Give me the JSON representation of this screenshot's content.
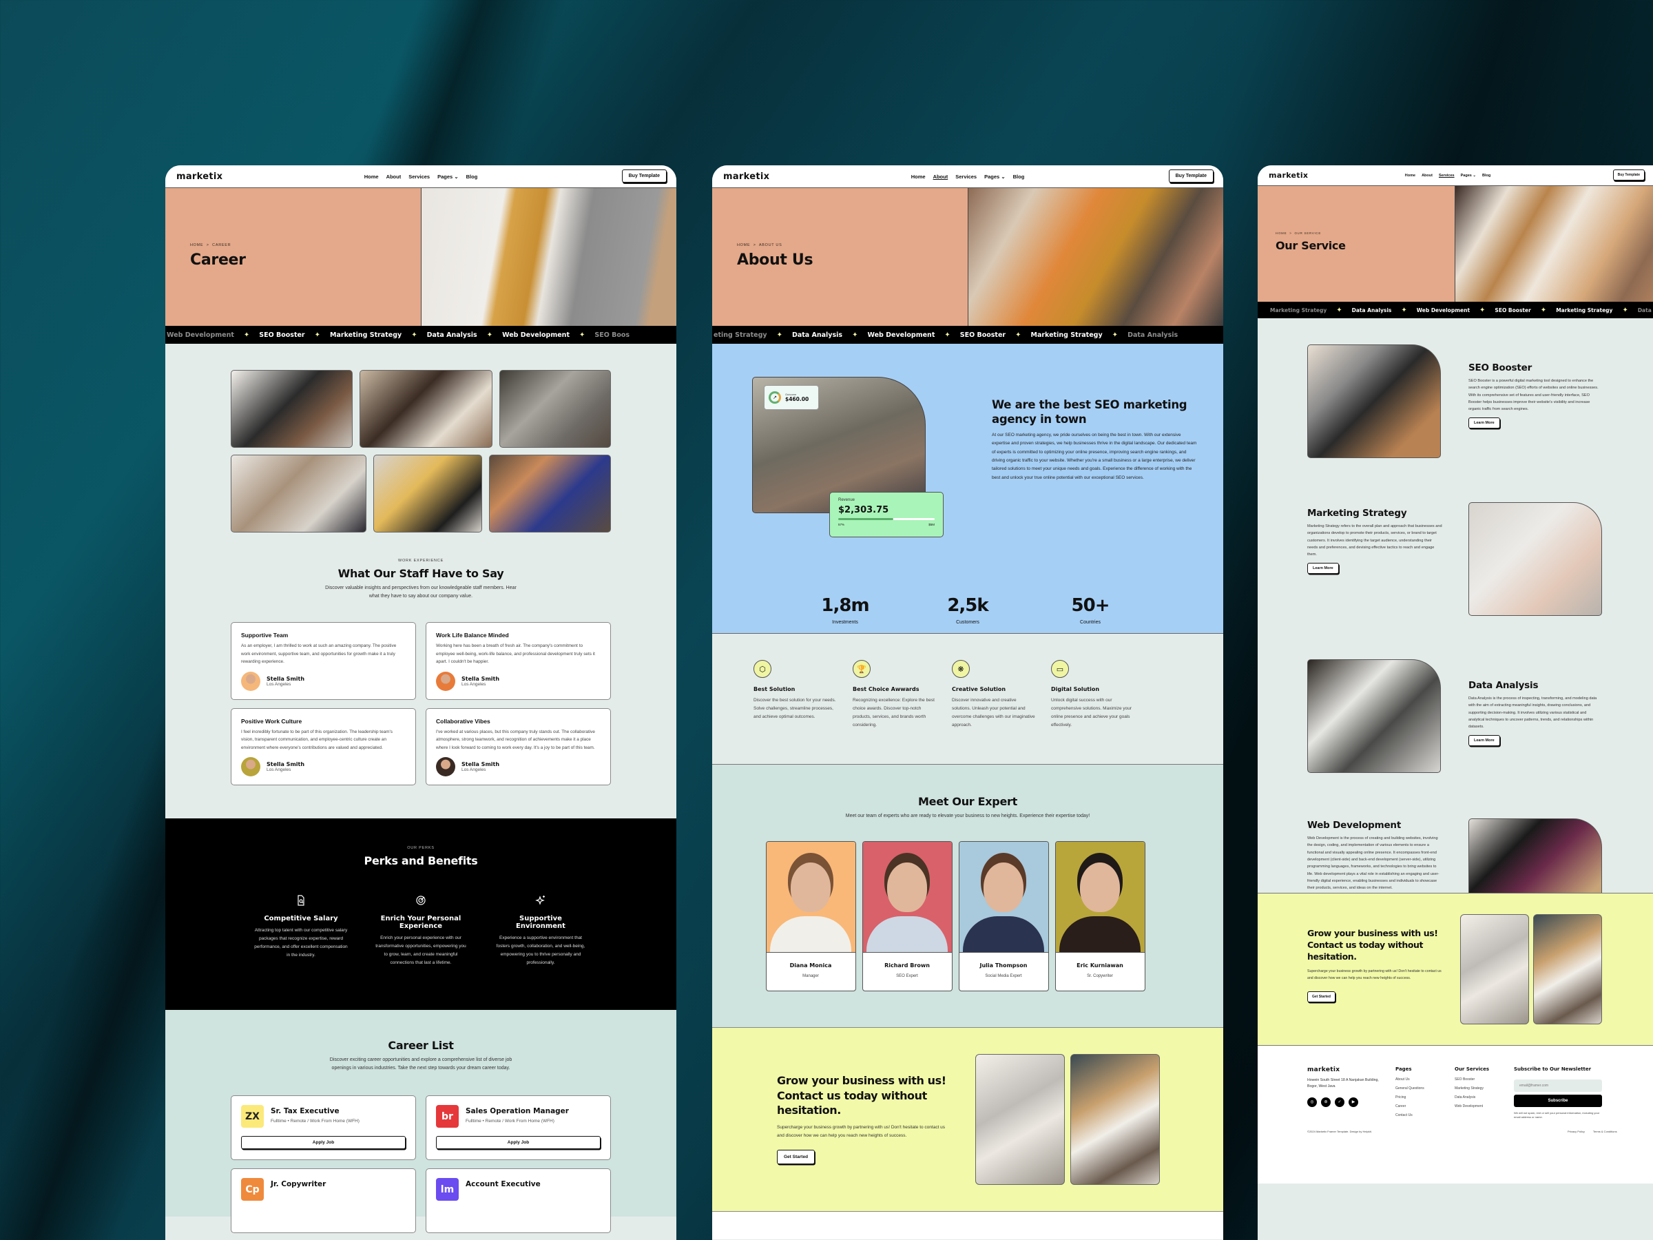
{
  "brand": "marketix",
  "nav": {
    "items": [
      "Home",
      "About",
      "Services",
      "Pages",
      "Blog"
    ],
    "buy_label": "Buy Template"
  },
  "ticker_items": [
    "Web Development",
    "SEO Booster",
    "Marketing Strategy",
    "Data Analysis"
  ],
  "career_page": {
    "active_nav": "",
    "breadcrumb": {
      "home": "HOME",
      "sep": ">",
      "current": "CAREER"
    },
    "title": "Career",
    "ticker": [
      "Web Development",
      "SEO Booster",
      "Marketing Strategy",
      "Data Analysis",
      "Web Development",
      "SEO Boos"
    ],
    "testimonials": {
      "eyebrow": "WORK EXPERIENCE",
      "title": "What Our Staff Have to Say",
      "subtitle": "Discover valuable insights and perspectives from our knowledgeable staff members. Hear what they have to say about our company value.",
      "cards": [
        {
          "title": "Supportive Team",
          "text": "As an employer, I am thrilled to work at such an amazing company. The positive work environment, supportive team, and opportunities for growth make it a truly rewarding experience.",
          "name": "Stella Smith",
          "location": "Los Angeles",
          "avatar_bg": "#f5b77a"
        },
        {
          "title": "Work Life Balance Minded",
          "text": "Working here has been a breath of fresh air. The company's commitment to employee well-being, work-life balance, and professional development truly sets it apart. I couldn't be happier.",
          "name": "Stella Smith",
          "location": "Los Angeles",
          "avatar_bg": "#e87b3a"
        },
        {
          "title": "Positive Work Culture",
          "text": "I feel incredibly fortunate to be part of this organization. The leadership team's vision, transparent communication, and employee-centric culture create an environment where everyone's contributions are valued and appreciated.",
          "name": "Stella Smith",
          "location": "Los Angeles",
          "avatar_bg": "#b8a43a"
        },
        {
          "title": "Collaborative Vibes",
          "text": "I've worked at various places, but this company truly stands out. The collaborative atmosphere, strong teamwork, and recognition of achievements make it a place where I look forward to coming to work every day. It's a joy to be part of this team.",
          "name": "Stella Smith",
          "location": "Los Angeles",
          "avatar_bg": "#3a2a24"
        }
      ]
    },
    "perks": {
      "eyebrow": "OUR PERKS",
      "title": "Perks and Benefits",
      "items": [
        {
          "icon": "document-search-icon",
          "title": "Competitive Salary",
          "text": "Attracting top talent with our competitive salary packages that recognize expertise, reward performance, and offer excellent compensation in the industry."
        },
        {
          "icon": "target-icon",
          "title": "Enrich Your Personal Experience",
          "text": "Enrich your personal experience with our transformative opportunities, empowering you to grow, learn, and create meaningful connections that last a lifetime."
        },
        {
          "icon": "sparkles-icon",
          "title": "Supportive Environment",
          "text": "Experience a supportive environment that fosters growth, collaboration, and well-being, empowering you to thrive personally and professionally."
        }
      ]
    },
    "career_list": {
      "title": "Career List",
      "subtitle": "Discover exciting career opportunities and explore a comprehensive list of diverse job openings in various industries. Take the next step towards your dream career today.",
      "jobs": [
        {
          "logo": "ZX",
          "logo_bg": "#fbe97a",
          "logo_fg": "#222",
          "title": "Sr. Tax Executive",
          "meta": "Fulltime • Remote / Work From Home (WFH)",
          "apply": "Apply Job"
        },
        {
          "logo": "br",
          "logo_bg": "#e5383b",
          "logo_fg": "#fff",
          "title": "Sales Operation Manager",
          "meta": "Fulltime • Remote / Work From Home (WFH)",
          "apply": "Apply Job"
        },
        {
          "logo": "Cp",
          "logo_bg": "#ef8a3c",
          "logo_fg": "#fff",
          "title": "Jr. Copywriter",
          "meta": "",
          "apply": ""
        },
        {
          "logo": "lm",
          "logo_bg": "#6a4cf0",
          "logo_fg": "#fff",
          "title": "Account Executive",
          "meta": "",
          "apply": ""
        }
      ]
    }
  },
  "about_page": {
    "active_nav": "About",
    "breadcrumb": {
      "home": "HOME",
      "sep": ">",
      "current": "ABOUT US"
    },
    "title": "About Us",
    "ticker": [
      "eting Strategy",
      "Data Analysis",
      "Web Development",
      "SEO Booster",
      "Marketing Strategy",
      "Data Analysis"
    ],
    "outcome": {
      "label": "Outcome",
      "value": "$460.00"
    },
    "revenue": {
      "label": "Revenue",
      "value": "$2,303.75",
      "progress_percent": 57,
      "left_label": "57%",
      "right_label": "$5M"
    },
    "intro": {
      "title": "We are the best SEO marketing agency in town",
      "text": "At our SEO marketing agency, we pride ourselves on being the best in town. With our extensive expertise and proven strategies, we help businesses thrive in the digital landscape. Our dedicated team of experts is committed to optimizing your online presence, improving search engine rankings, and driving organic traffic to your website. Whether you're a small business or a large enterprise, we deliver tailored solutions to meet your unique needs and goals. Experience the difference of working with the best and unlock your true online potential with our exceptional SEO services."
    },
    "stats": [
      {
        "value": "1,8m",
        "label": "Investments"
      },
      {
        "value": "2,5k",
        "label": "Customers"
      },
      {
        "value": "50+",
        "label": "Countries"
      }
    ],
    "features": [
      {
        "icon": "box-icon",
        "glyph": "⬡",
        "title": "Best Solution",
        "text": "Discover the best solution for your needs. Solve challenges, streamline processes, and achieve optimal outcomes."
      },
      {
        "icon": "trophy-icon",
        "glyph": "🏆",
        "title": "Best Choice Awwards",
        "text": "Recognizing excellence: Explore the best choice awards. Discover top-notch products, services, and brands worth considering."
      },
      {
        "icon": "brain-icon",
        "glyph": "❋",
        "title": "Creative Solution",
        "text": "Discover innovative and creative solutions. Unleash your potential and overcome challenges with our imaginative approach."
      },
      {
        "icon": "devices-icon",
        "glyph": "▭",
        "title": "Digital Solution",
        "text": "Unlock digital success with our comprehensive solutions. Maximize your online presence and achieve your goals effectively."
      }
    ],
    "experts": {
      "title": "Meet Our Expert",
      "subtitle": "Meet our team of experts who are ready to elevate your business to new heights. Experience their expertise today!",
      "members": [
        {
          "name": "Diana Monica",
          "role": "Manager",
          "bg": "#f9b878",
          "hair": "#7a5236",
          "shirt": "#f1efe9"
        },
        {
          "name": "Richard Brown",
          "role": "SEO Expert",
          "bg": "#d9616a",
          "hair": "#4a3324",
          "shirt": "#cdd8e4"
        },
        {
          "name": "Julia Thompson",
          "role": "Social Media Expert",
          "bg": "#a9c9dc",
          "hair": "#5a3a28",
          "shirt": "#2a3350"
        },
        {
          "name": "Eric Kurniawan",
          "role": "Sr. Copywriter",
          "bg": "#b9a63b",
          "hair": "#1f1a18",
          "shirt": "#2a1e1a"
        }
      ]
    },
    "cta": {
      "title": "Grow your business with us! Contact us today without hesitation.",
      "text": "Supercharge your business growth by partnering with us! Don't hesitate to contact us and discover how we can help you reach new heights of success.",
      "button": "Get Started"
    }
  },
  "service_page": {
    "active_nav": "Services",
    "breadcrumb": {
      "home": "HOME",
      "sep": ">",
      "current": "OUR SERVICE"
    },
    "title": "Our Service",
    "ticker": [
      "Marketing Strategy",
      "Data Analysis",
      "Web Development",
      "SEO Booster",
      "Marketing Strategy",
      "Data"
    ],
    "services": [
      {
        "title": "SEO Booster",
        "text": "SEO Booster is a powerful digital marketing tool designed to enhance the search engine optimization (SEO) efforts of websites and online businesses. With its comprehensive set of features and user-friendly interface, SEO Booster helps businesses improve their website's visibility and increase organic traffic from search engines.",
        "button": "Learn More"
      },
      {
        "title": "Marketing Strategy",
        "text": "Marketing Strategy refers to the overall plan and approach that businesses and organizations develop to promote their products, services, or brand to target customers. It involves identifying the target audience, understanding their needs and preferences, and devising effective tactics to reach and engage them.",
        "button": "Learn More"
      },
      {
        "title": "Data Analysis",
        "text": "Data Analysis is the process of inspecting, transforming, and modeling data with the aim of extracting meaningful insights, drawing conclusions, and supporting decision-making. It involves utilizing various statistical and analytical techniques to uncover patterns, trends, and relationships within datasets.",
        "button": "Learn More"
      },
      {
        "title": "Web Development",
        "text": "Web Development is the process of creating and building websites, involving the design, coding, and implementation of various elements to ensure a functional and visually appealing online presence. It encompasses front-end development (client-side) and back-end development (server-side), utilizing programming languages, frameworks, and technologies to bring websites to life. Web development plays a vital role in establishing an engaging and user-friendly digital experience, enabling businesses and individuals to showcase their products, services, and ideas on the internet.",
        "button": "Learn More"
      }
    ],
    "cta": {
      "title": "Grow your business with us! Contact us today without hesitation.",
      "text": "Supercharge your business growth by partnering with us! Don't hesitate to contact us and discover how we can help you reach new heights of success.",
      "button": "Get Started"
    },
    "footer": {
      "address": "Howein South Street 18 A Nanjakan Building, Bogor, West Java",
      "social": [
        "instagram-icon",
        "dribbble-icon",
        "twitter-icon",
        "youtube-icon"
      ],
      "pages_title": "Pages",
      "pages": [
        "About Us",
        "General Questions",
        "Pricing",
        "Career",
        "Contact Us"
      ],
      "services_title": "Our Services",
      "services": [
        "SEO Booster",
        "Marketing Strategy",
        "Data Analysis",
        "Web Development"
      ],
      "newsletter_title": "Subscribe to Our Newsletter",
      "email_placeholder": "email@framer.com",
      "subscribe": "Subscribe",
      "disclaimer": "We will not spam, rent or sell your personal information, including your email address or name.",
      "copyright": "©2024 Marketix Framer Template. Design by Helpkit.",
      "privacy": "Privacy Policy",
      "terms": "Terms & Conditions"
    }
  }
}
